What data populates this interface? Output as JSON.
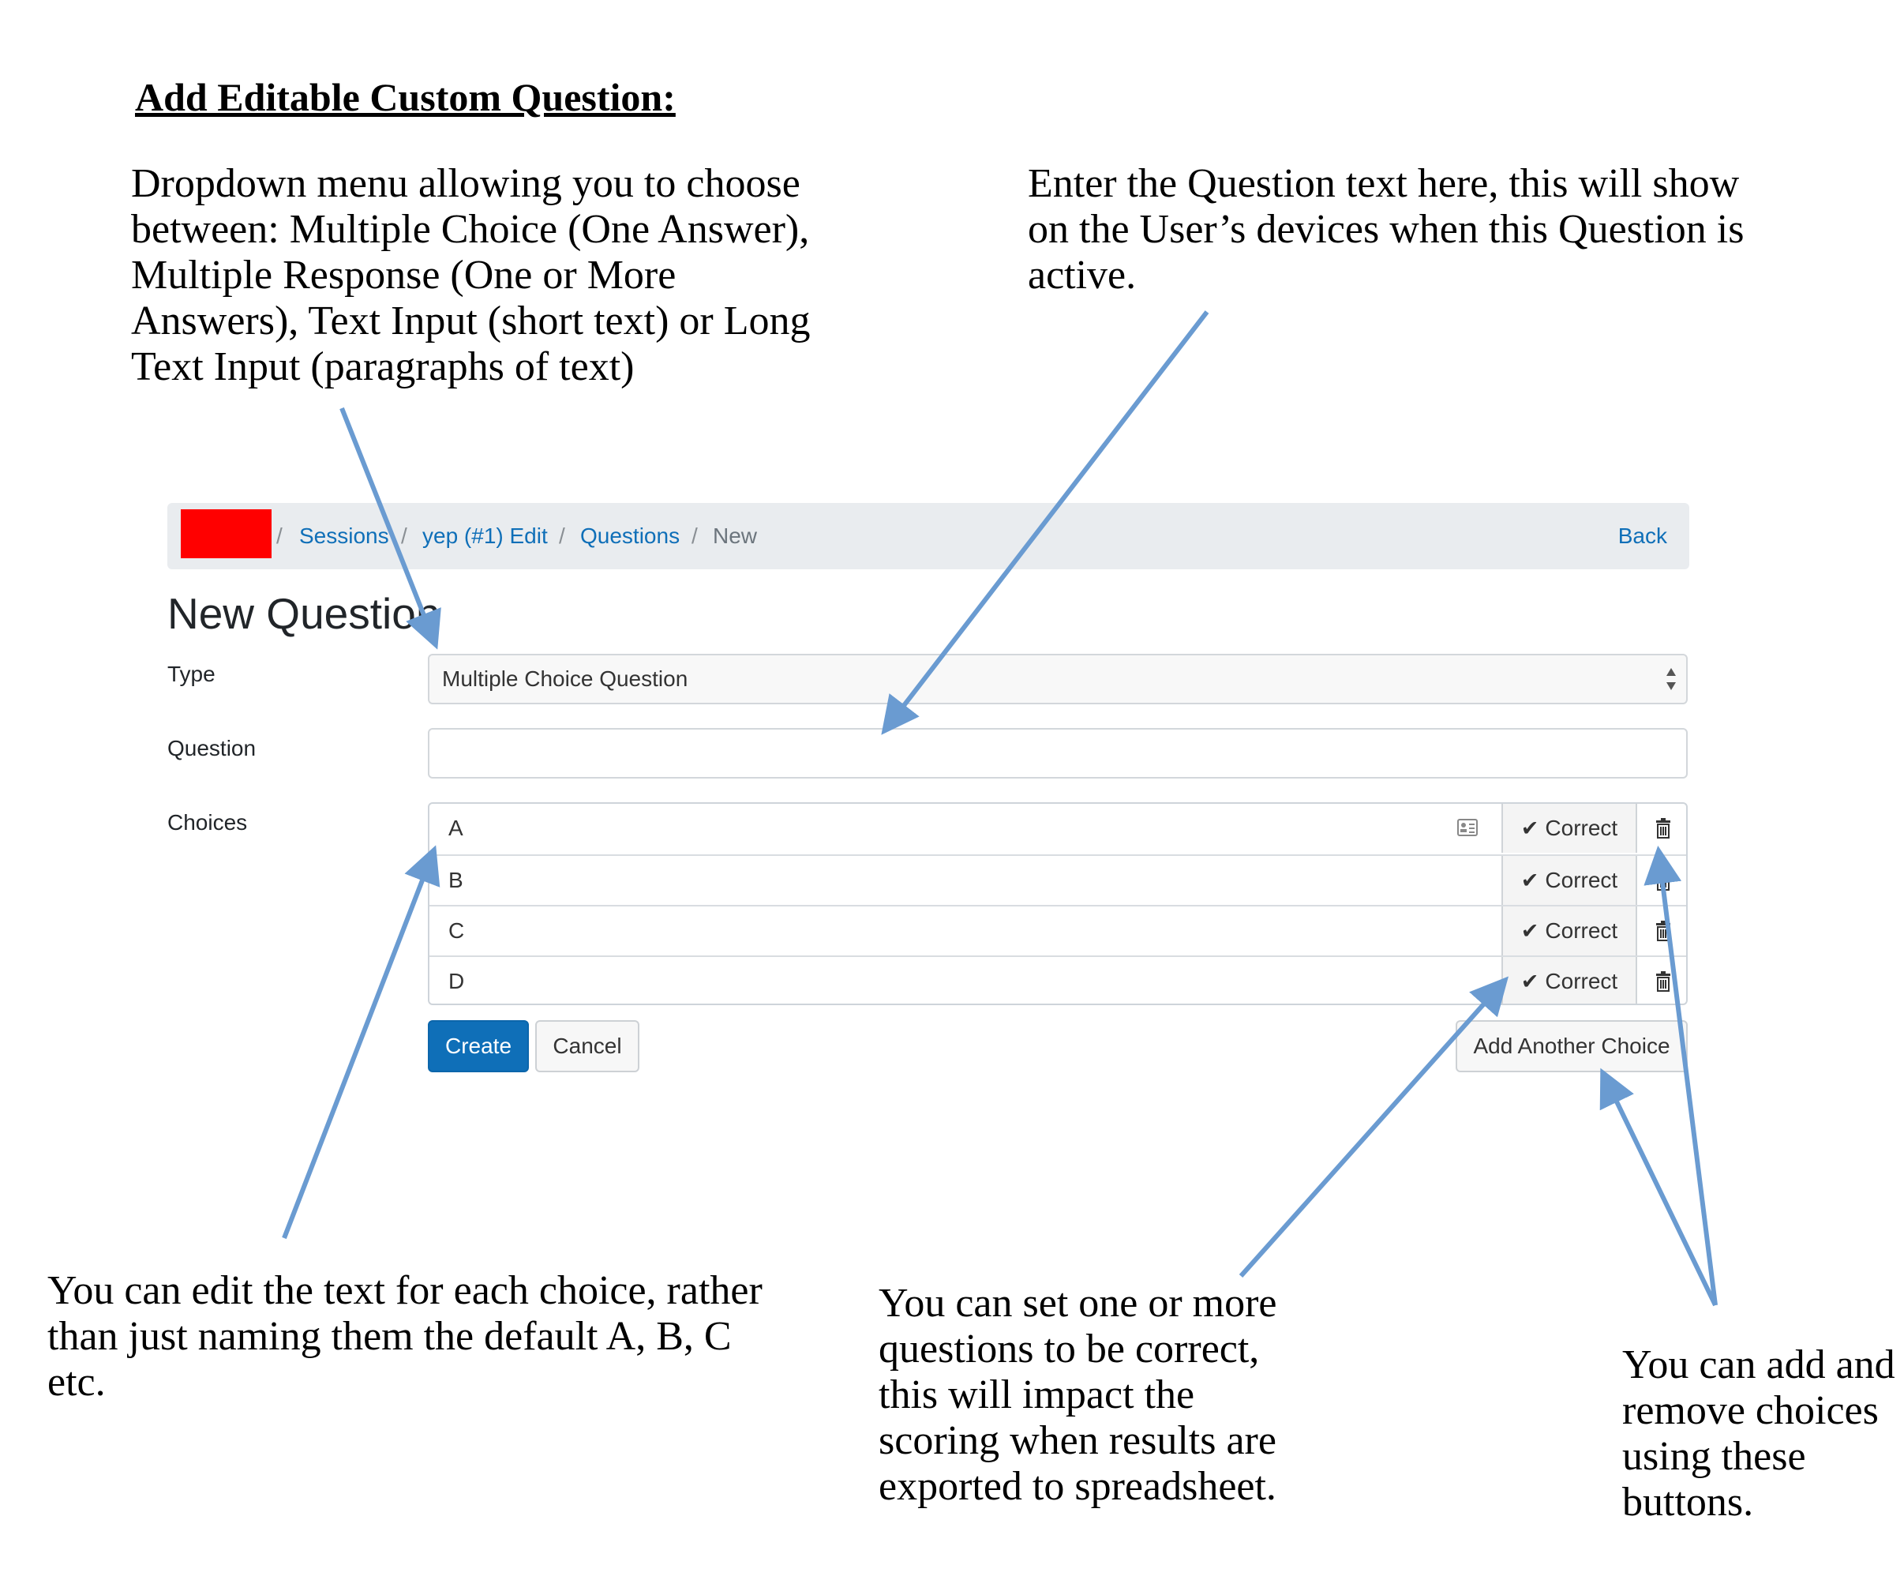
{
  "document": {
    "title": "Add Editable Custom Question:",
    "notes": {
      "type_dropdown": [
        "Dropdown menu allowing you to choose",
        "between: Multiple Choice (One Answer),",
        "Multiple Response (One or More",
        "Answers), Text Input (short text) or Long",
        "Text Input (paragraphs of text)"
      ],
      "question_text": [
        "Enter the Question text here, this will show",
        "on the User’s devices when this Question is",
        "active."
      ],
      "edit_choices": [
        "You can edit the text for each choice, rather",
        "than just naming them the default A, B, C",
        "etc."
      ],
      "set_correct": [
        "You can set one or more",
        "questions to be correct,",
        "this will impact the",
        "scoring when results are",
        "exported to spreadsheet."
      ],
      "add_remove": [
        "You can add and",
        "remove choices",
        "using these",
        "buttons."
      ]
    },
    "arrow_color": "#6a9bd1"
  },
  "app": {
    "breadcrumb": {
      "separator": "/",
      "items": [
        "Sessions",
        "yep (#1) Edit",
        "Questions"
      ],
      "active": "New",
      "back_label": "Back"
    },
    "page_title": "New Question",
    "form": {
      "type_label": "Type",
      "type_value": "Multiple Choice Question",
      "question_label": "Question",
      "question_value": "",
      "choices_label": "Choices",
      "choices": [
        {
          "text": "A",
          "correct_label": "Correct"
        },
        {
          "text": "B",
          "correct_label": "Correct"
        },
        {
          "text": "C",
          "correct_label": "Correct"
        },
        {
          "text": "D",
          "correct_label": "Correct"
        }
      ],
      "create_label": "Create",
      "cancel_label": "Cancel",
      "add_choice_label": "Add Another Choice"
    },
    "colors": {
      "link": "#0f6fb8",
      "primary_button": "#0f6fb8",
      "breadcrumb_bg": "#e9ecef",
      "logo_redaction": "#ff0000"
    }
  }
}
